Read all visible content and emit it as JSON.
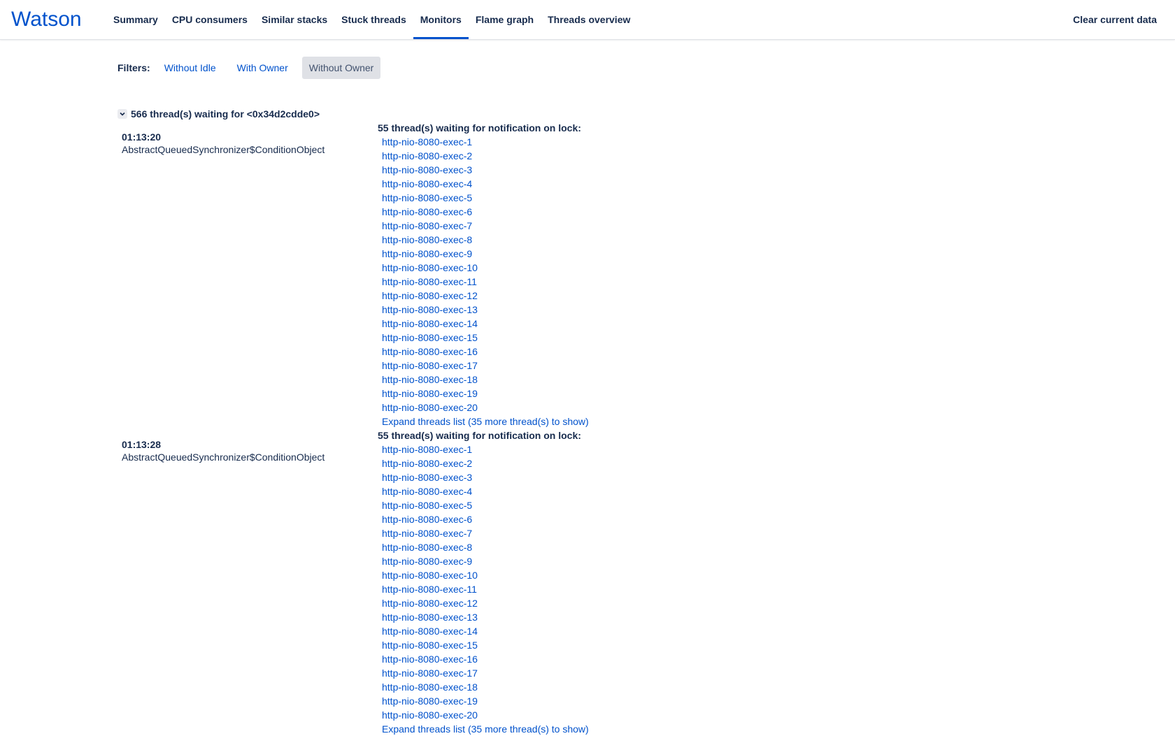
{
  "app": {
    "title": "Watson"
  },
  "nav": {
    "items": [
      {
        "label": "Summary",
        "active": false
      },
      {
        "label": "CPU consumers",
        "active": false
      },
      {
        "label": "Similar stacks",
        "active": false
      },
      {
        "label": "Stuck threads",
        "active": false
      },
      {
        "label": "Monitors",
        "active": true
      },
      {
        "label": "Flame graph",
        "active": false
      },
      {
        "label": "Threads overview",
        "active": false
      }
    ],
    "clear_label": "Clear current data"
  },
  "filters": {
    "label": "Filters:",
    "options": [
      {
        "label": "Without Idle",
        "selected": false
      },
      {
        "label": "With Owner",
        "selected": false
      },
      {
        "label": "Without Owner",
        "selected": true
      }
    ]
  },
  "group": {
    "title": "566 thread(s) waiting for <0x34d2cdde0>",
    "snapshots": [
      {
        "time": "01:13:20",
        "class_name": "AbstractQueuedSynchronizer$ConditionObject",
        "lock_title": "55 thread(s) waiting for notification on lock:",
        "threads": [
          "http-nio-8080-exec-1",
          "http-nio-8080-exec-2",
          "http-nio-8080-exec-3",
          "http-nio-8080-exec-4",
          "http-nio-8080-exec-5",
          "http-nio-8080-exec-6",
          "http-nio-8080-exec-7",
          "http-nio-8080-exec-8",
          "http-nio-8080-exec-9",
          "http-nio-8080-exec-10",
          "http-nio-8080-exec-11",
          "http-nio-8080-exec-12",
          "http-nio-8080-exec-13",
          "http-nio-8080-exec-14",
          "http-nio-8080-exec-15",
          "http-nio-8080-exec-16",
          "http-nio-8080-exec-17",
          "http-nio-8080-exec-18",
          "http-nio-8080-exec-19",
          "http-nio-8080-exec-20"
        ],
        "expand_label": "Expand threads list (35 more thread(s) to show)"
      },
      {
        "time": "01:13:28",
        "class_name": "AbstractQueuedSynchronizer$ConditionObject",
        "lock_title": "55 thread(s) waiting for notification on lock:",
        "threads": [
          "http-nio-8080-exec-1",
          "http-nio-8080-exec-2",
          "http-nio-8080-exec-3",
          "http-nio-8080-exec-4",
          "http-nio-8080-exec-5",
          "http-nio-8080-exec-6",
          "http-nio-8080-exec-7",
          "http-nio-8080-exec-8",
          "http-nio-8080-exec-9",
          "http-nio-8080-exec-10",
          "http-nio-8080-exec-11",
          "http-nio-8080-exec-12",
          "http-nio-8080-exec-13",
          "http-nio-8080-exec-14",
          "http-nio-8080-exec-15",
          "http-nio-8080-exec-16",
          "http-nio-8080-exec-17",
          "http-nio-8080-exec-18",
          "http-nio-8080-exec-19",
          "http-nio-8080-exec-20"
        ],
        "expand_label": "Expand threads list (35 more thread(s) to show)"
      }
    ]
  },
  "icons": {
    "group_toggle": "chevron-down-icon"
  },
  "colors": {
    "link": "#0052cc",
    "text": "#172b4d",
    "accent": "#0052cc",
    "selected_bg": "#dfe1e6"
  }
}
